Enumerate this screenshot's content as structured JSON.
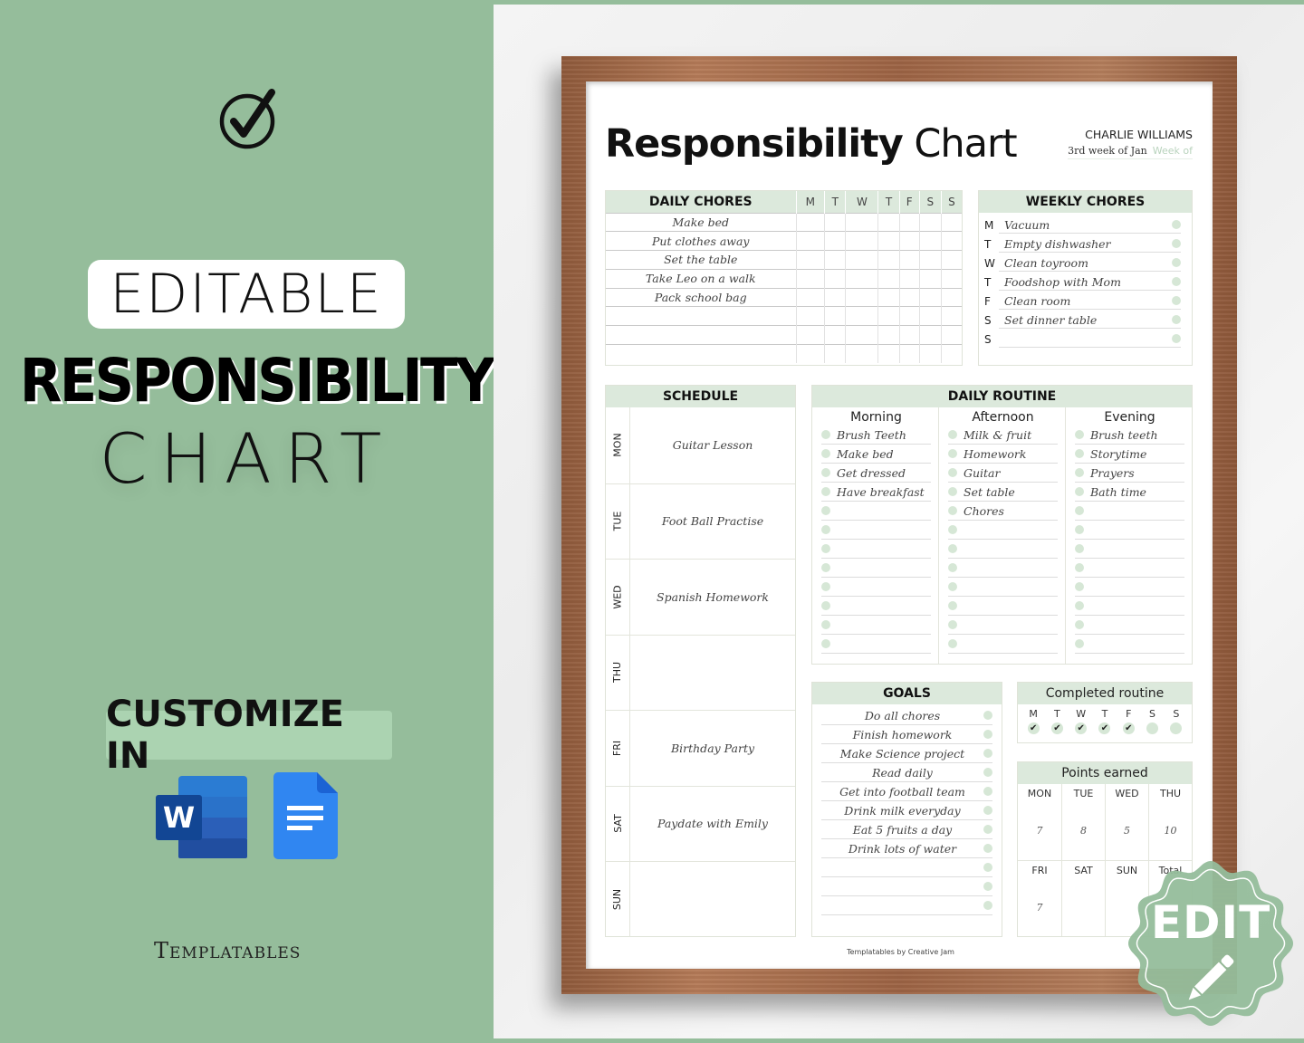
{
  "promo": {
    "editable_label": "EDITABLE",
    "headline": "RESPONSIBILITY",
    "subheadline": "CHART",
    "customize_label": "CUSTOMIZE IN",
    "apps": [
      "Microsoft Word",
      "Google Docs"
    ],
    "word_letter": "W",
    "brand": "Templatables",
    "edit_badge": "EDIT"
  },
  "colors": {
    "sage": "#95bd9b",
    "header_green": "#dce9dc",
    "dot_green": "#d6e7d6"
  },
  "document": {
    "title_bold": "Responsibility",
    "title_light": "Chart",
    "name": "CHARLIE WILLIAMS",
    "week_value": "3rd week of Jan",
    "week_placeholder": "Week of",
    "footer": "Templatables by Creative Jam",
    "daily_chores": {
      "title": "DAILY CHORES",
      "days": [
        "M",
        "T",
        "W",
        "T",
        "F",
        "S",
        "S"
      ],
      "rows": [
        "Make bed",
        "Put clothes away",
        "Set the table",
        "Take Leo on a walk",
        "Pack school bag",
        "",
        "",
        ""
      ]
    },
    "weekly_chores": {
      "title": "WEEKLY CHORES",
      "rows": [
        {
          "day": "M",
          "task": "Vacuum"
        },
        {
          "day": "T",
          "task": "Empty dishwasher"
        },
        {
          "day": "W",
          "task": "Clean toyroom"
        },
        {
          "day": "T",
          "task": "Foodshop with Mom"
        },
        {
          "day": "F",
          "task": "Clean room"
        },
        {
          "day": "S",
          "task": "Set dinner table"
        },
        {
          "day": "S",
          "task": ""
        }
      ]
    },
    "schedule": {
      "title": "SCHEDULE",
      "rows": [
        {
          "day": "MON",
          "event": "Guitar Lesson"
        },
        {
          "day": "TUE",
          "event": "Foot Ball Practise"
        },
        {
          "day": "WED",
          "event": "Spanish Homework"
        },
        {
          "day": "THU",
          "event": ""
        },
        {
          "day": "FRI",
          "event": "Birthday Party"
        },
        {
          "day": "SAT",
          "event": "Paydate with Emily"
        },
        {
          "day": "SUN",
          "event": ""
        }
      ]
    },
    "daily_routine": {
      "title": "DAILY ROUTINE",
      "columns": [
        {
          "label": "Morning",
          "items": [
            "Brush Teeth",
            "Make bed",
            "Get dressed",
            "Have breakfast",
            "",
            "",
            "",
            "",
            "",
            "",
            "",
            ""
          ]
        },
        {
          "label": "Afternoon",
          "items": [
            "Milk & fruit",
            "Homework",
            "Guitar",
            "Set table",
            "Chores",
            "",
            "",
            "",
            "",
            "",
            "",
            ""
          ]
        },
        {
          "label": "Evening",
          "items": [
            "Brush teeth",
            "Storytime",
            "Prayers",
            "Bath time",
            "",
            "",
            "",
            "",
            "",
            "",
            "",
            ""
          ]
        }
      ]
    },
    "goals": {
      "title": "GOALS",
      "items": [
        "Do all chores",
        "Finish homework",
        "Make Science project",
        "Read daily",
        "Get into football team",
        "Drink milk everyday",
        "Eat 5 fruits a day",
        "Drink lots of water",
        "",
        "",
        ""
      ]
    },
    "completed_routine": {
      "title": "Completed routine",
      "days": [
        {
          "day": "M",
          "done": true
        },
        {
          "day": "T",
          "done": true
        },
        {
          "day": "W",
          "done": true
        },
        {
          "day": "T",
          "done": true
        },
        {
          "day": "F",
          "done": true
        },
        {
          "day": "S",
          "done": false
        },
        {
          "day": "S",
          "done": false
        }
      ],
      "check_glyph": "✔"
    },
    "points_earned": {
      "title": "Points earned",
      "cells": [
        {
          "day": "MON",
          "value": "7"
        },
        {
          "day": "TUE",
          "value": "8"
        },
        {
          "day": "WED",
          "value": "5"
        },
        {
          "day": "THU",
          "value": "10"
        },
        {
          "day": "FRI",
          "value": "7"
        },
        {
          "day": "SAT",
          "value": ""
        },
        {
          "day": "SUN",
          "value": ""
        },
        {
          "day": "Total",
          "value": ""
        }
      ]
    }
  }
}
